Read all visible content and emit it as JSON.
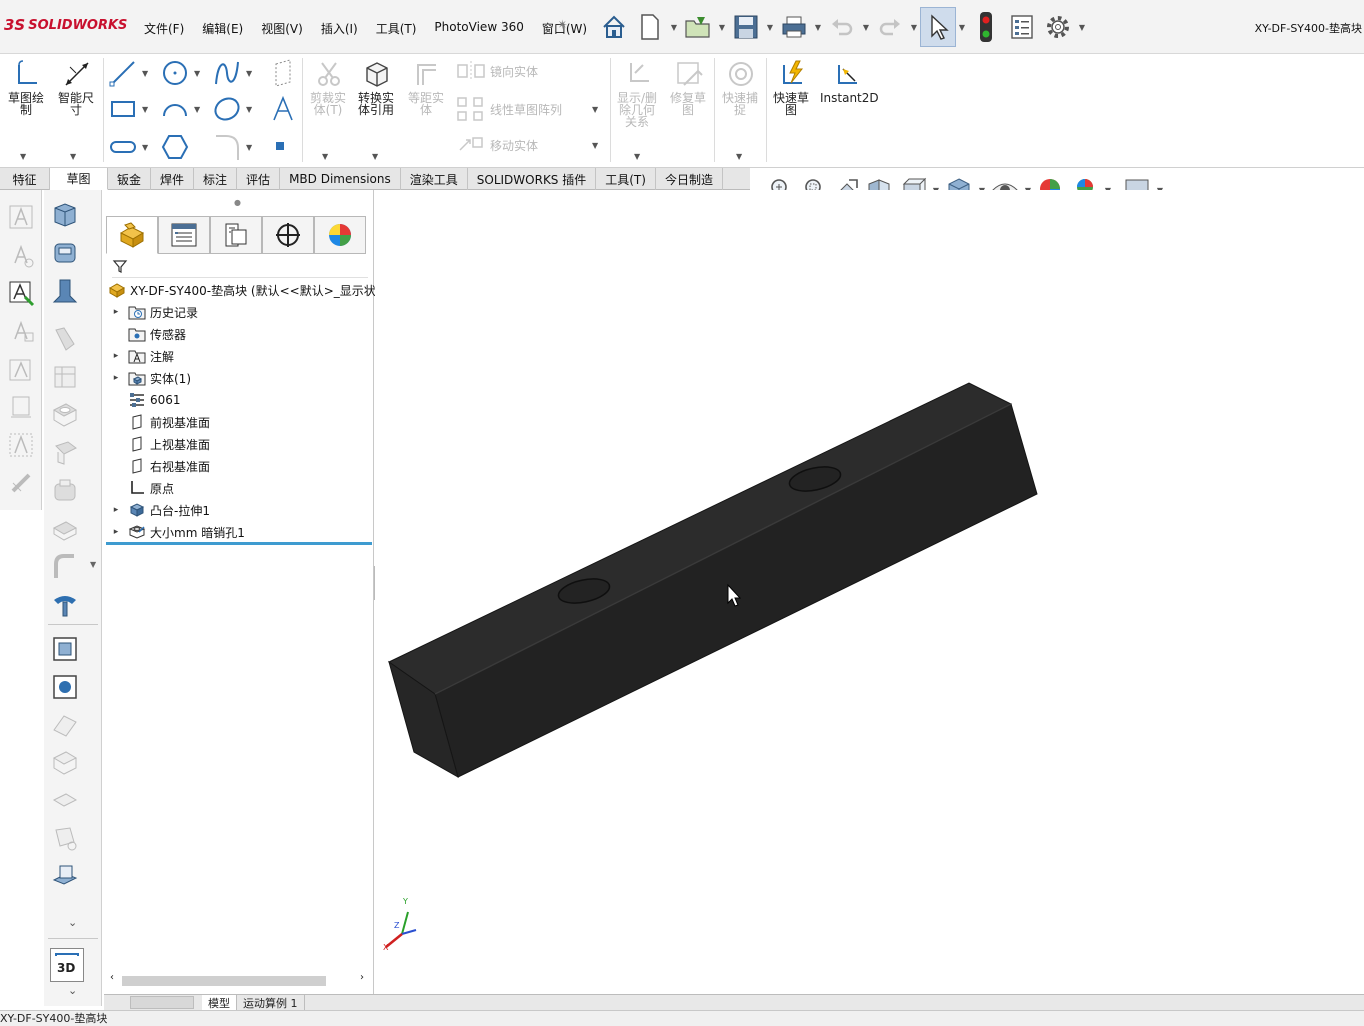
{
  "app": {
    "logo_mark": "3S",
    "logo_text": "SOLIDWORKS",
    "document_title": "XY-DF-SY400-垫高块"
  },
  "menu": [
    "文件(F)",
    "编辑(E)",
    "视图(V)",
    "插入(I)",
    "工具(T)",
    "PhotoView 360",
    "窗口(W)"
  ],
  "ribbon": {
    "sketch": "草图绘制",
    "smart_dim": "智能尺寸",
    "trim": "剪裁实体(T)",
    "convert": "转换实体引用",
    "offset": "等距实体",
    "mirror": "镜向实体",
    "linear_pattern": "线性草图阵列",
    "move": "移动实体",
    "display_relations": "显示/删除几何关系",
    "repair": "修复草图",
    "quick_snaps": "快速捕捉",
    "rapid_sketch": "快速草图",
    "instant2d": "Instant2D"
  },
  "tabs": [
    "特征",
    "草图",
    "钣金",
    "焊件",
    "标注",
    "评估",
    "MBD Dimensions",
    "渲染工具",
    "SOLIDWORKS 插件",
    "工具(T)",
    "今日制造"
  ],
  "active_tab": "草图",
  "tree": {
    "root": "XY-DF-SY400-垫高块  (默认<<默认>_显示状",
    "items": [
      {
        "label": "历史记录",
        "expandable": true,
        "icon": "history-folder-icon"
      },
      {
        "label": "传感器",
        "expandable": false,
        "icon": "sensor-folder-icon"
      },
      {
        "label": "注解",
        "expandable": true,
        "icon": "annotation-folder-icon"
      },
      {
        "label": "实体(1)",
        "expandable": true,
        "icon": "solid-bodies-folder-icon"
      },
      {
        "label": "6061",
        "expandable": false,
        "icon": "material-icon"
      },
      {
        "label": "前视基准面",
        "expandable": false,
        "icon": "plane-icon"
      },
      {
        "label": "上视基准面",
        "expandable": false,
        "icon": "plane-icon"
      },
      {
        "label": "右视基准面",
        "expandable": false,
        "icon": "plane-icon"
      },
      {
        "label": "原点",
        "expandable": false,
        "icon": "origin-icon"
      },
      {
        "label": "凸台-拉伸1",
        "expandable": true,
        "icon": "extrude-feature-icon"
      },
      {
        "label": "大小mm 暗销孔1",
        "expandable": true,
        "icon": "hole-wizard-icon"
      }
    ]
  },
  "bottom_tabs": [
    "模型",
    "运动算例 1"
  ],
  "status_text": "XY-DF-SY400-垫高块",
  "triad": {
    "x": "X",
    "y": "Y",
    "z": "Z"
  },
  "colors": {
    "brand": "#c8102e",
    "body": "#262626",
    "rollback": "#3e9bd0"
  }
}
